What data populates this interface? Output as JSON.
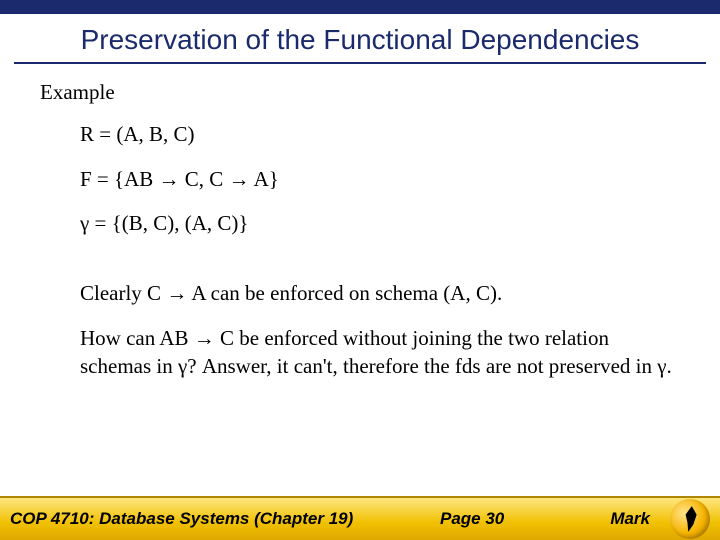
{
  "title": "Preservation of the Functional Dependencies",
  "example_label": "Example",
  "lines": {
    "r": "R = (A, B, C)",
    "f": "F = {AB → C, C → A}",
    "gamma": "γ = {(B, C), (A, C)}",
    "clearly": "Clearly C → A can be enforced on schema (A, C).",
    "how": "How can AB → C be enforced without joining the two relation schemas in γ?  Answer, it can't, therefore the fds are not preserved in γ."
  },
  "footer": {
    "course": "COP 4710: Database Systems  (Chapter 19)",
    "page": "Page 30",
    "author": "Mark"
  }
}
